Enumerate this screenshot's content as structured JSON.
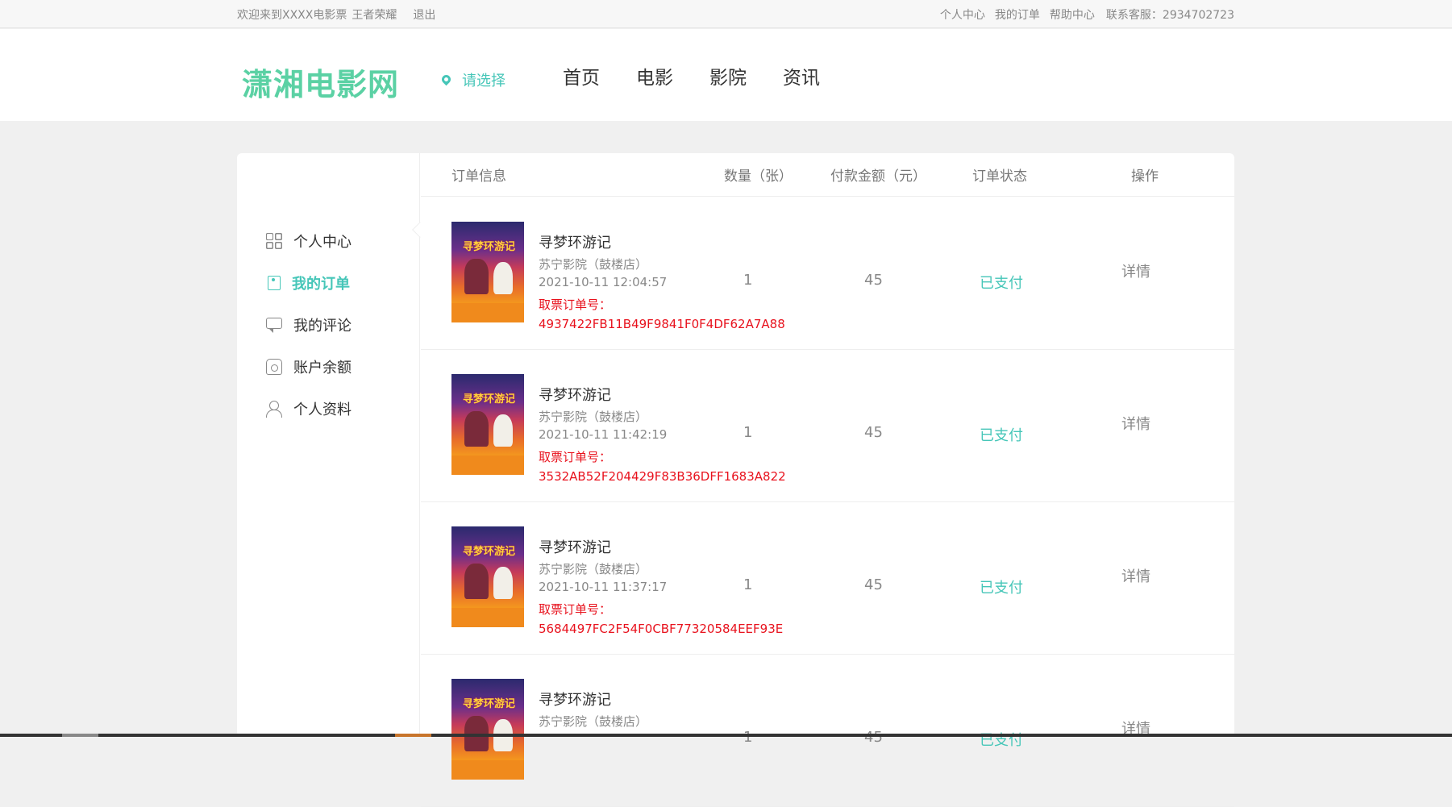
{
  "topbar": {
    "welcome": "欢迎来到XXXX电影票",
    "username": "王者荣耀",
    "logout": "退出",
    "links": [
      "个人中心",
      "我的订单",
      "帮助中心"
    ],
    "contact": "联系客服：2934702723"
  },
  "header": {
    "logo": "潇湘电影网",
    "location": "请选择",
    "nav": [
      "首页",
      "电影",
      "影院",
      "资讯"
    ]
  },
  "sidebar": {
    "items": [
      {
        "label": "个人中心",
        "icon": "grid-icon",
        "active": false
      },
      {
        "label": "我的订单",
        "icon": "tag-icon",
        "active": true
      },
      {
        "label": "我的评论",
        "icon": "chat-icon",
        "active": false
      },
      {
        "label": "账户余额",
        "icon": "wallet-icon",
        "active": false
      },
      {
        "label": "个人资料",
        "icon": "user-icon",
        "active": false
      }
    ]
  },
  "table": {
    "headers": [
      "订单信息",
      "数量（张）",
      "付款金额（元）",
      "订单状态",
      "操作"
    ],
    "rows": [
      {
        "poster_text": "寻梦环游记",
        "title": "寻梦环游记",
        "cinema": "苏宁影院（鼓楼店）",
        "time": "2021-10-11 12:04:57",
        "ticket_label": "取票订单号：",
        "ticket_code": "4937422FB11B49F9841F0F4DF62A7A88",
        "qty": "1",
        "amount": "45",
        "status": "已支付",
        "action": "详情"
      },
      {
        "poster_text": "寻梦环游记",
        "title": "寻梦环游记",
        "cinema": "苏宁影院（鼓楼店）",
        "time": "2021-10-11 11:42:19",
        "ticket_label": "取票订单号：",
        "ticket_code": "3532AB52F204429F83B36DFF1683A822",
        "qty": "1",
        "amount": "45",
        "status": "已支付",
        "action": "详情"
      },
      {
        "poster_text": "寻梦环游记",
        "title": "寻梦环游记",
        "cinema": "苏宁影院（鼓楼店）",
        "time": "2021-10-11 11:37:17",
        "ticket_label": "取票订单号：",
        "ticket_code": "5684497FC2F54F0CBF77320584EEF93E",
        "qty": "1",
        "amount": "45",
        "status": "已支付",
        "action": "详情"
      },
      {
        "poster_text": "寻梦环游记",
        "title": "寻梦环游记",
        "cinema": "苏宁影院（鼓楼店）",
        "time": "",
        "ticket_label": "",
        "ticket_code": "",
        "qty": "1",
        "amount": "45",
        "status": "已支付",
        "action": "详情"
      }
    ]
  },
  "colors": {
    "accent": "#46c6b8",
    "logo": "#5bd1a4",
    "ticket": "#e8121d"
  }
}
